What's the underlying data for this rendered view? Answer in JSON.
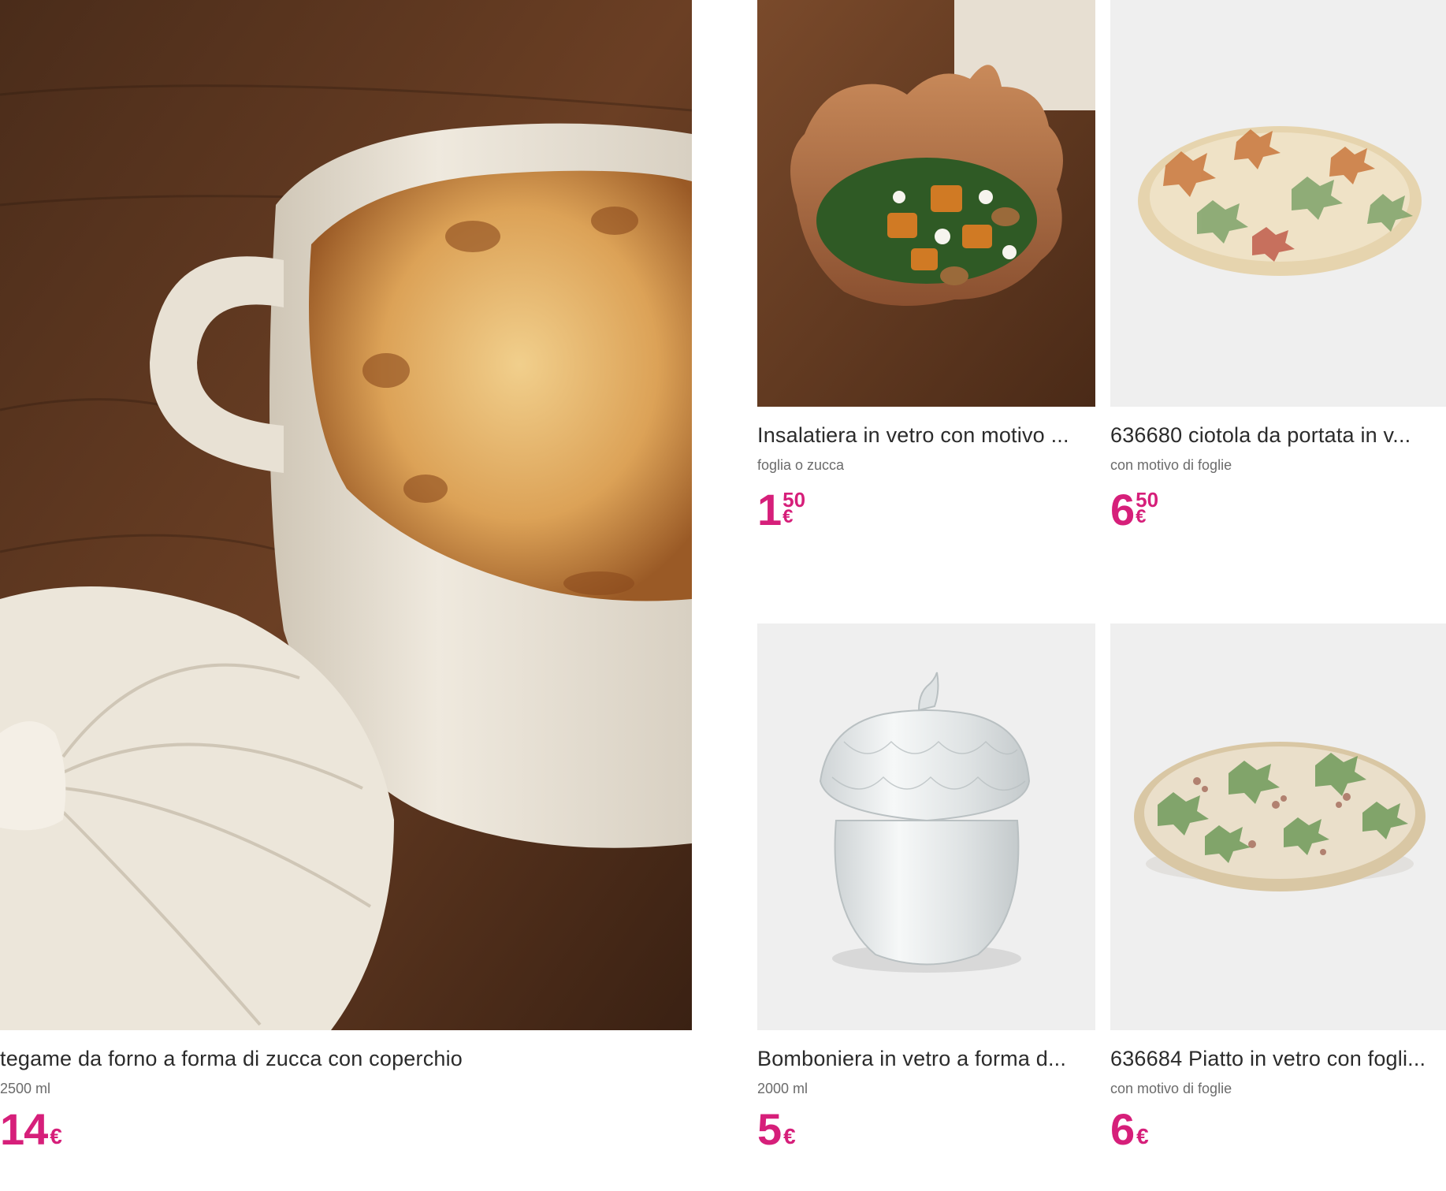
{
  "products": [
    {
      "title": "tegame da forno a forma di zucca con coperchio",
      "subtitle": "2500 ml",
      "price_int": "14",
      "price_dec": "",
      "currency": "€",
      "image_desc": "pumpkin-shaped ceramic baking dish"
    },
    {
      "title": "Insalatiera in vetro con motivo ...",
      "subtitle": "foglia o zucca",
      "price_int": "1",
      "price_dec": "50",
      "currency": "€",
      "image_desc": "leaf-shaped glass salad bowl"
    },
    {
      "title": "636680 ciotola da portata in v...",
      "subtitle": "con motivo di foglie",
      "price_int": "6",
      "price_dec": "50",
      "currency": "€",
      "image_desc": "glass serving bowl with leaf pattern"
    },
    {
      "title": "Bomboniera in vetro a forma d...",
      "subtitle": "2000 ml",
      "price_int": "5",
      "price_dec": "",
      "currency": "€",
      "image_desc": "glass candy jar"
    },
    {
      "title": "636684 Piatto in vetro con fogli...",
      "subtitle": "con motivo di foglie",
      "price_int": "6",
      "price_dec": "",
      "currency": "€",
      "image_desc": "glass plate with leaves"
    }
  ],
  "colors": {
    "price": "#d61f7a",
    "image_bg": "#eeeeee"
  }
}
